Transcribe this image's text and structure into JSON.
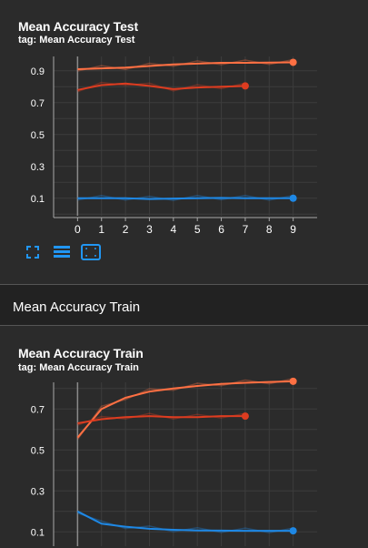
{
  "chart_test": {
    "title": "Mean Accuracy Test",
    "tag": "tag: Mean Accuracy Test",
    "chart_data": {
      "type": "line",
      "title": "Mean Accuracy Test",
      "x_ticks": [
        0,
        1,
        2,
        3,
        4,
        5,
        6,
        7,
        8,
        9
      ],
      "y_ticks": [
        0.1,
        0.3,
        0.5,
        0.7,
        0.9
      ],
      "xlim": [
        -1,
        10
      ],
      "ylim": [
        -0.01,
        0.99
      ],
      "grid": true,
      "series": [
        {
          "color": "#ff7043",
          "x": [
            0,
            1,
            2,
            3,
            4,
            5,
            6,
            7,
            8,
            9
          ],
          "y": [
            0.91,
            0.915,
            0.92,
            0.93,
            0.94,
            0.945,
            0.95,
            0.95,
            0.952,
            0.953
          ]
        },
        {
          "color": "#dd3c20",
          "x": [
            0,
            1,
            2,
            3,
            4,
            5,
            6,
            7
          ],
          "y": [
            0.78,
            0.81,
            0.82,
            0.805,
            0.785,
            0.795,
            0.8,
            0.805
          ]
        },
        {
          "color": "#1e88e5",
          "x": [
            0,
            1,
            2,
            3,
            4,
            5,
            6,
            7,
            8,
            9
          ],
          "y": [
            0.1,
            0.1,
            0.1,
            0.095,
            0.098,
            0.1,
            0.102,
            0.1,
            0.1,
            0.1
          ]
        }
      ]
    },
    "toolbar": {
      "expand_icon": "fullscreen-icon",
      "lines_icon": "toggle-log-scale-icon",
      "fit_icon": "fit-domain-icon"
    }
  },
  "section": {
    "title": "Mean Accuracy Train"
  },
  "chart_train": {
    "title": "Mean Accuracy Train",
    "tag": "tag: Mean Accuracy Train",
    "chart_data": {
      "type": "line",
      "title": "Mean Accuracy Train",
      "y_ticks": [
        0.1,
        0.3,
        0.5,
        0.7
      ],
      "xlim": [
        -1,
        10
      ],
      "ylim": [
        0.03,
        0.83
      ],
      "grid": true,
      "series": [
        {
          "color": "#ff7043",
          "x": [
            0,
            1,
            2,
            3,
            4,
            5,
            6,
            7,
            8,
            9
          ],
          "y": [
            0.56,
            0.7,
            0.755,
            0.785,
            0.8,
            0.812,
            0.822,
            0.828,
            0.832,
            0.835
          ]
        },
        {
          "color": "#dd3c20",
          "x": [
            0,
            1,
            2,
            3,
            4,
            5,
            6,
            7
          ],
          "y": [
            0.63,
            0.65,
            0.66,
            0.665,
            0.66,
            0.66,
            0.665,
            0.665
          ]
        },
        {
          "color": "#1e88e5",
          "x": [
            0,
            1,
            2,
            3,
            4,
            5,
            6,
            7,
            8,
            9
          ],
          "y": [
            0.2,
            0.14,
            0.125,
            0.115,
            0.11,
            0.107,
            0.106,
            0.105,
            0.105,
            0.105
          ]
        }
      ]
    }
  }
}
